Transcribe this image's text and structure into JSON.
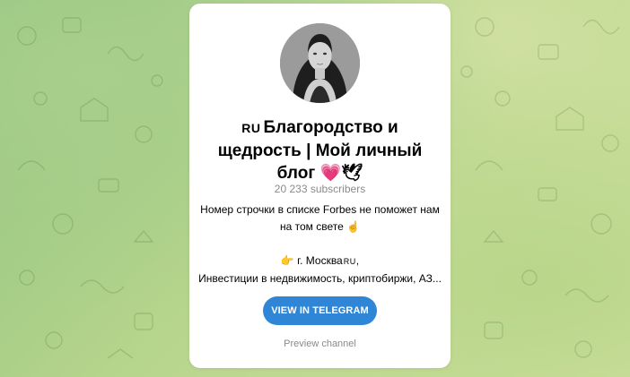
{
  "channel": {
    "flag": "RU",
    "title": "Благородство и щедрость | Мой личный блог",
    "title_emoji_heart": "💗",
    "title_emoji_dove": "🕊",
    "subscribers": "20 233 subscribers",
    "description_line1": "Номер строчки в списке Forbes не поможет нам",
    "description_line2": "на том свете ☝",
    "location_line": "👉 г. Москва",
    "location_flag": "RU",
    "location_suffix": ",",
    "interests_line": "Инвестиции в недвижимость, криптобиржи, АЗ..."
  },
  "actions": {
    "view_label": "VIEW IN TELEGRAM",
    "preview_label": "Preview channel"
  },
  "colors": {
    "button": "#2f86d6",
    "muted_text": "#8a8a8a",
    "background_accent": "#a9cf8c"
  },
  "icons": {
    "heart": "heart-emoji-icon",
    "dove": "dove-emoji-icon"
  }
}
